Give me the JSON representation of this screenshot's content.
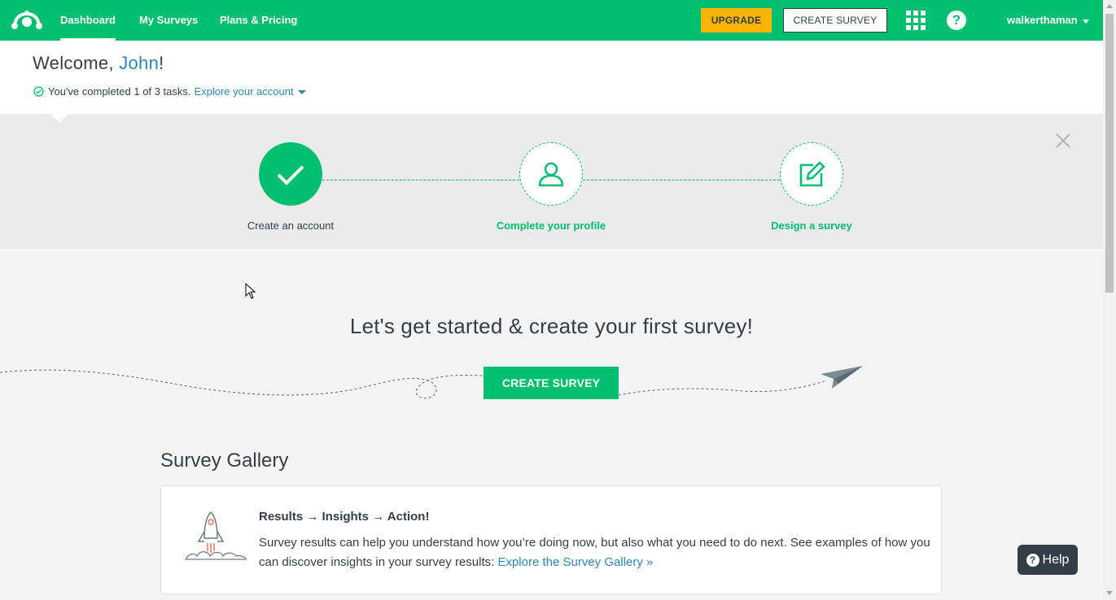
{
  "nav": {
    "items": [
      {
        "label": "Dashboard",
        "active": true
      },
      {
        "label": "My Surveys",
        "active": false
      },
      {
        "label": "Plans & Pricing",
        "active": false
      }
    ],
    "upgrade_label": "UPGRADE",
    "create_label": "CREATE SURVEY",
    "apps_icon": "apps-grid-icon",
    "help_icon": "help-circle-icon",
    "help_glyph": "?",
    "username": "walkerthaman"
  },
  "welcome": {
    "greeting": "Welcome, ",
    "name": "John",
    "punct": "!",
    "tasks_text": "You've completed 1 of 3 tasks.",
    "explore_label": "Explore your account"
  },
  "steps": [
    {
      "label": "Create an account",
      "status": "done",
      "icon": "checkmark-icon"
    },
    {
      "label": "Complete your profile",
      "status": "todo",
      "icon": "user-icon"
    },
    {
      "label": "Design a survey",
      "status": "todo",
      "icon": "edit-icon"
    }
  ],
  "main": {
    "heading": "Let's get started & create your first survey!",
    "create_label": "CREATE SURVEY"
  },
  "gallery": {
    "title": "Survey Gallery",
    "card_title": "Results → Insights → Action!",
    "card_body": "Survey results can help you understand how you’re doing now, but also what you need to do next. See examples of how you can discover insights in your survey results: ",
    "card_link": "Explore the Survey Gallery »"
  },
  "help": {
    "label": "Help",
    "glyph": "?"
  },
  "colors": {
    "brand": "#00bf6f",
    "upgrade": "#f7b500",
    "link": "#2a87b7",
    "text": "#333e48"
  }
}
